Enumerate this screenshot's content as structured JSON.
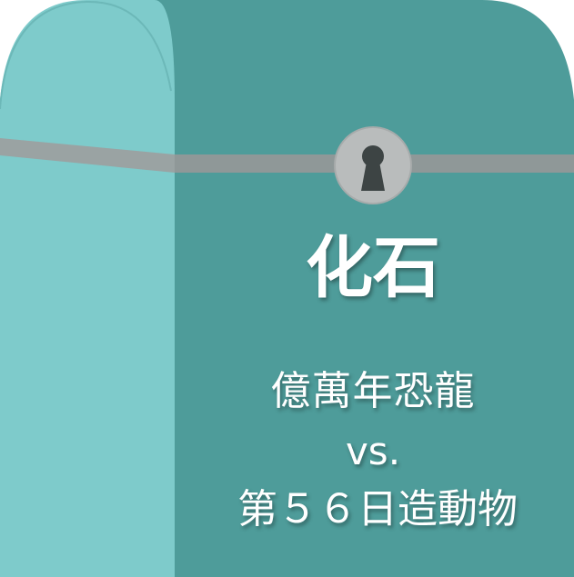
{
  "title": "化石",
  "subtitle_line_1": "億萬年恐龍",
  "subtitle_line_2": "vs.",
  "subtitle_line_3": "第５６日造動物",
  "colors": {
    "front_face": "#4e9c9a",
    "side_face": "#7ecbcb",
    "strap": "#9aa3a3",
    "lock_plate": "#b9bcbc",
    "keyhole": "#3d4444",
    "text": "#ffffff"
  },
  "icons": {
    "lock": "keyhole-lock-icon"
  }
}
